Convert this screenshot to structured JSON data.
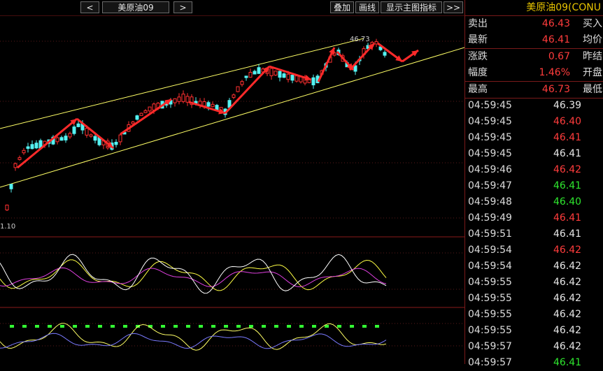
{
  "toolbar": {
    "prev": "<",
    "symbol": "美原油09",
    "next": ">",
    "overlay": "叠加",
    "draw_line": "画线",
    "indicator": "显示主图指标",
    "more": ">>"
  },
  "chart": {
    "high_label": "46.73",
    "low_label": "1.10",
    "colors": {
      "up": "#ff3030",
      "down": "#54f2f2",
      "channel": "#ffff66",
      "arrow": "#ff2a2a",
      "k": "#ffff44",
      "d": "#e040e0",
      "j": "#ffffff",
      "macd_dots": "#33ff33",
      "macd_line1": "#ffff66",
      "macd_line2": "#7a7aff"
    }
  },
  "panel": {
    "title": "美原油09(CONU",
    "quote": [
      {
        "label": "卖出",
        "value": "46.43",
        "label2": "买入"
      },
      {
        "label": "最新",
        "value": "46.41",
        "label2": "均价"
      },
      {
        "label": "涨跌",
        "value": "0.67",
        "label2": "昨结"
      },
      {
        "label": "幅度",
        "value": "1.46%",
        "label2": "开盘"
      },
      {
        "label": "最高",
        "value": "46.73",
        "label2": "最低"
      }
    ],
    "ticks": [
      {
        "time": "04:59:45",
        "price": "46.39",
        "color": "white"
      },
      {
        "time": "04:59:45",
        "price": "46.40",
        "color": "red"
      },
      {
        "time": "04:59:45",
        "price": "46.41",
        "color": "red"
      },
      {
        "time": "04:59:45",
        "price": "46.41",
        "color": "white"
      },
      {
        "time": "04:59:46",
        "price": "46.42",
        "color": "red"
      },
      {
        "time": "04:59:47",
        "price": "46.41",
        "color": "green"
      },
      {
        "time": "04:59:48",
        "price": "46.40",
        "color": "green"
      },
      {
        "time": "04:59:49",
        "price": "46.41",
        "color": "red"
      },
      {
        "time": "04:59:51",
        "price": "46.41",
        "color": "white"
      },
      {
        "time": "04:59:54",
        "price": "46.42",
        "color": "red"
      },
      {
        "time": "04:59:54",
        "price": "46.42",
        "color": "white"
      },
      {
        "time": "04:59:55",
        "price": "46.42",
        "color": "white"
      },
      {
        "time": "04:59:55",
        "price": "46.42",
        "color": "white"
      },
      {
        "time": "04:59:55",
        "price": "46.42",
        "color": "white"
      },
      {
        "time": "04:59:55",
        "price": "46.42",
        "color": "white"
      },
      {
        "time": "04:59:57",
        "price": "46.42",
        "color": "white"
      },
      {
        "time": "04:59:57",
        "price": "46.41",
        "color": "green"
      }
    ]
  }
}
